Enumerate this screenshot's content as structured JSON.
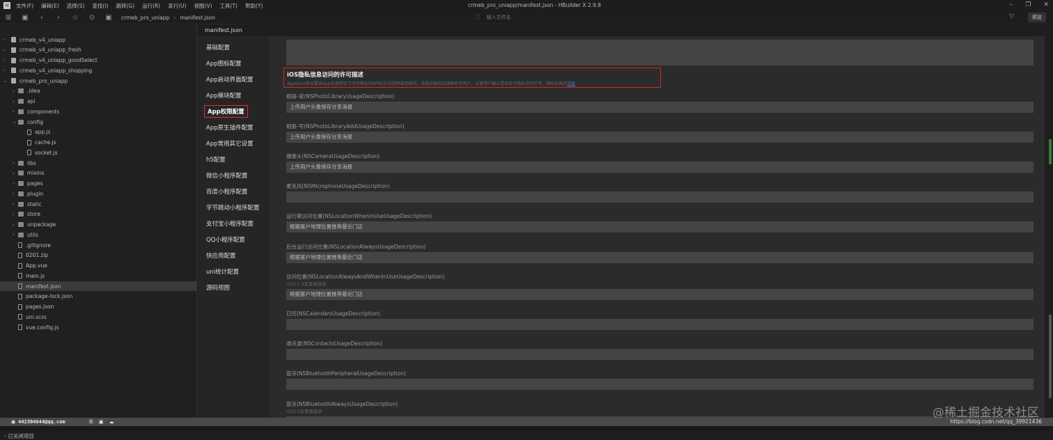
{
  "app": {
    "logo": "H",
    "title": "crmeb_pro_uniapp/manifest.json - HBuilder X 2.9.8",
    "menu": [
      "文件(F)",
      "编辑(E)",
      "选择(S)",
      "查找(I)",
      "跳转(G)",
      "运行(R)",
      "发行(U)",
      "视图(V)",
      "工具(T)",
      "帮助(Y)"
    ]
  },
  "toolbar": {
    "breadcrumb": [
      "crmeb_pro_uniapp",
      "manifest.json"
    ],
    "file_search_placeholder": "输入文件名",
    "preview_label": "预览"
  },
  "sidebar": {
    "items": [
      {
        "label": "crmeb_v4_uniapp",
        "type": "project",
        "depth": 0,
        "arrow": "›"
      },
      {
        "label": "crmeb_v4_uniapp_fresh",
        "type": "project",
        "depth": 0,
        "arrow": "›"
      },
      {
        "label": "crmeb_v4_uniapp_goodSelect",
        "type": "project",
        "depth": 0,
        "arrow": "›"
      },
      {
        "label": "crmeb_v4_uniapp_shopping",
        "type": "project",
        "depth": 0,
        "arrow": "›"
      },
      {
        "label": "crmeb_pro_uniapp",
        "type": "project",
        "depth": 0,
        "arrow": "⌄"
      },
      {
        "label": ".idea",
        "type": "folder",
        "depth": 1,
        "arrow": "›"
      },
      {
        "label": "api",
        "type": "folder",
        "depth": 1,
        "arrow": "›"
      },
      {
        "label": "components",
        "type": "folder",
        "depth": 1,
        "arrow": "›"
      },
      {
        "label": "config",
        "type": "folder",
        "depth": 1,
        "arrow": "⌄"
      },
      {
        "label": "app.js",
        "type": "file",
        "depth": 2,
        "arrow": ""
      },
      {
        "label": "cache.js",
        "type": "file",
        "depth": 2,
        "arrow": ""
      },
      {
        "label": "socket.js",
        "type": "file",
        "depth": 2,
        "arrow": ""
      },
      {
        "label": "libs",
        "type": "folder",
        "depth": 1,
        "arrow": "›"
      },
      {
        "label": "mixins",
        "type": "folder",
        "depth": 1,
        "arrow": "›"
      },
      {
        "label": "pages",
        "type": "folder",
        "depth": 1,
        "arrow": "›"
      },
      {
        "label": "plugin",
        "type": "folder",
        "depth": 1,
        "arrow": "›"
      },
      {
        "label": "static",
        "type": "folder",
        "depth": 1,
        "arrow": "›"
      },
      {
        "label": "store",
        "type": "folder",
        "depth": 1,
        "arrow": "›"
      },
      {
        "label": "unpackage",
        "type": "folder",
        "depth": 1,
        "arrow": "›"
      },
      {
        "label": "utils",
        "type": "folder",
        "depth": 1,
        "arrow": "›"
      },
      {
        "label": ".gitignore",
        "type": "file",
        "depth": 1,
        "arrow": ""
      },
      {
        "label": "0201.zip",
        "type": "file",
        "depth": 1,
        "arrow": ""
      },
      {
        "label": "App.vue",
        "type": "file",
        "depth": 1,
        "arrow": ""
      },
      {
        "label": "main.js",
        "type": "file",
        "depth": 1,
        "arrow": ""
      },
      {
        "label": "manifest.json",
        "type": "file",
        "depth": 1,
        "arrow": "",
        "selected": true
      },
      {
        "label": "package-lock.json",
        "type": "file",
        "depth": 1,
        "arrow": ""
      },
      {
        "label": "pages.json",
        "type": "file",
        "depth": 1,
        "arrow": ""
      },
      {
        "label": "uni.scss",
        "type": "file",
        "depth": 1,
        "arrow": ""
      },
      {
        "label": "vue.config.js",
        "type": "file",
        "depth": 1,
        "arrow": ""
      }
    ],
    "closed_projects": "已关闭项目"
  },
  "editor": {
    "tab": "manifest.json"
  },
  "config_nav": {
    "items": [
      "基础配置",
      "App图标配置",
      "App启动界面配置",
      "App模块配置",
      "App权限配置",
      "App原生插件配置",
      "App常用其它设置",
      "h5配置",
      "微信小程序配置",
      "百度小程序配置",
      "字节跳动小程序配置",
      "支付宝小程序配置",
      "QQ小程序配置",
      "快应用配置",
      "uni统计配置",
      "源码视图"
    ],
    "active": 4
  },
  "privacy": {
    "title": "iOS隐私信息访问的许可描述",
    "desc": "Appstore审核要求App在调用如下涉及隐私的API时必须说明调用原因，该描述原因会弹框给予用户，以便用户确认是否给予隐私访问许可。国际化描述",
    "link": "详见",
    "fields": [
      {
        "label": "相册-读(NSPhotoLibraryUsageDescription)",
        "sub": "",
        "value": "上传用户头像保存分享海报"
      },
      {
        "label": "相册-写(NSPhotoLibraryAddUsageDescription)",
        "sub": "",
        "value": "上传用户头像保存分享海报"
      },
      {
        "label": "摄像头(NSCameraUsageDescription)",
        "sub": "",
        "value": "上传用户头像保存分享海报"
      },
      {
        "label": "麦克风(NSMicrophoneUsageDescription)",
        "sub": "",
        "value": ""
      },
      {
        "label": "运行期访问位置(NSLocationWhenInUseUsageDescription)",
        "sub": "",
        "value": "根据客户地理位置推荐最近门店"
      },
      {
        "label": "后台运行访问位置(NSLocationAlwaysUsageDescription)",
        "sub": "",
        "value": "根据客户地理位置推荐最近门店"
      },
      {
        "label": "访问位置(NSLocationAlwaysAndWhenInUseUsageDescription)",
        "sub": "iOS11.3及更高版本",
        "value": "根据客户地理位置推荐最近门店"
      },
      {
        "label": "日历(NSCalendarsUsageDescription)",
        "sub": "",
        "value": ""
      },
      {
        "label": "通讯录(NSContactsUsageDescription)",
        "sub": "",
        "value": ""
      },
      {
        "label": "蓝牙(NSBluetoothPeripheralUsageDescription)",
        "sub": "",
        "value": ""
      },
      {
        "label": "蓝牙(NSBluetoothAlwaysUsageDescription)",
        "sub": "iOS13及更高版本",
        "value": ""
      }
    ]
  },
  "status": {
    "user": "442304644@qq.com",
    "url": "https://blog.csdn.net/qq_39921436"
  },
  "watermark": "@稀土掘金技术社区"
}
